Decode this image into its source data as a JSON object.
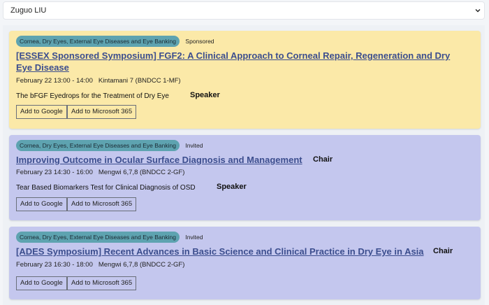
{
  "speaker_select": {
    "value": "Zuguo LIU"
  },
  "cards": [
    {
      "tag": "Cornea, Dry Eyes, External Eye Diseases and Eye Banking",
      "type": "Sponsored",
      "title_line1": "[ESSEX Sponsored Symposium] FGF2: A Clinical Approach to Corneal Repair, Regeneration and Dry",
      "title_line2": "Eye Disease",
      "datetime": "February 22 13:00 - 14:00",
      "location": "Kintamani 7 (BNDCC 1-MF)",
      "talk": "The bFGF Eyedrops for the Treatment of Dry Eye",
      "talk_role": "Speaker",
      "google_label": "Add to Google",
      "ms_label": "Add to Microsoft 365"
    },
    {
      "tag": "Cornea, Dry Eyes, External Eye Diseases and Eye Banking",
      "type": "Invited",
      "title_line1": "Improving Outcome in Ocular Surface Diagnosis and Management",
      "session_role": "Chair",
      "datetime": "February 23 14:30 - 16:00",
      "location": "Mengwi 6,7,8 (BNDCC 2-GF)",
      "talk": "Tear Based Biomarkers Test for Clinical Diagnosis of OSD",
      "talk_role": "Speaker",
      "google_label": "Add to Google",
      "ms_label": "Add to Microsoft 365"
    },
    {
      "tag": "Cornea, Dry Eyes, External Eye Diseases and Eye Banking",
      "type": "Invited",
      "title_line1": "[ADES Symposium] Recent Advances in Basic Science and Clinical Practice in Dry Eye in Asia",
      "session_role": "Chair",
      "datetime": "February 23 16:30 - 18:00",
      "location": "Mengwi 6,7,8 (BNDCC 2-GF)",
      "google_label": "Add to Google",
      "ms_label": "Add to Microsoft 365"
    }
  ],
  "colors": {
    "sponsored_card": "#fbe9a8",
    "invited_card": "#c4c7ee",
    "tag": "#5ea3b0",
    "title_link": "#3c4e8e"
  },
  "icons": {
    "select_arrow": "chevron-down-icon"
  }
}
